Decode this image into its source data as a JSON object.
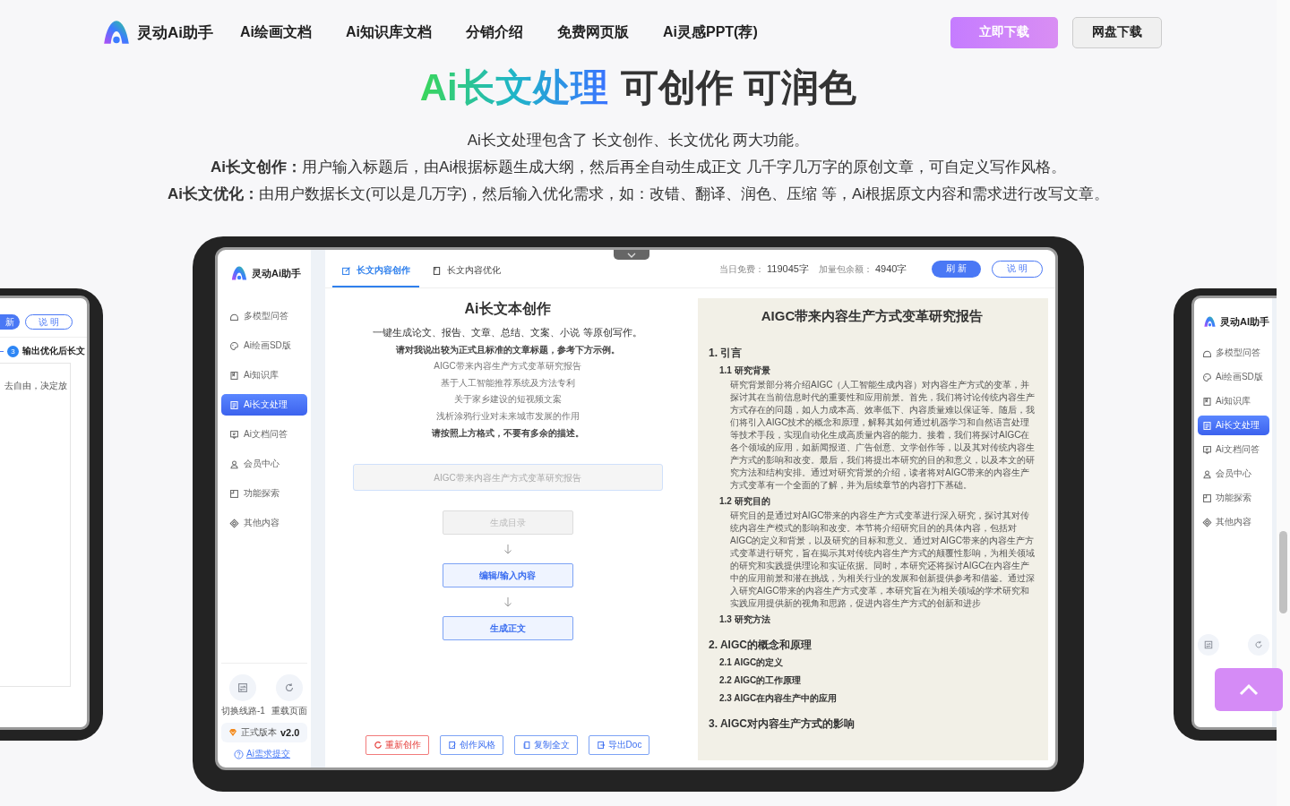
{
  "header": {
    "logo_text": "灵动Ai助手",
    "nav": [
      {
        "label": "Ai绘画文档"
      },
      {
        "label": "Ai知识库文档"
      },
      {
        "label": "分销介绍"
      },
      {
        "label": "免费网页版"
      },
      {
        "label": "Ai灵感PPT(荐)"
      }
    ],
    "buttons": [
      {
        "label": "立即下载",
        "kind": "primary"
      },
      {
        "label": "网盘下载",
        "kind": "secondary"
      }
    ]
  },
  "hero": {
    "title_highlight": "Ai长文处理",
    "title_rest": "可创作 可润色",
    "lines": [
      "Ai长文处理包含了 长文创作、长文优化 两大功能。",
      "**Ai长文创作：**用户输入标题后，由Ai根据标题生成大纲，然后再全自动生成正文 几千字几万字的原创文章，可自定义写作风格。",
      "**Ai长文优化：**由用户数据长文(可以是几万字)，然后输入优化需求，如：改错、翻译、润色、压缩 等，Ai根据原文内容和需求进行改写文章。"
    ]
  },
  "left_device": {
    "buttons": [
      {
        "label": "新",
        "kind": "primary"
      },
      {
        "label": "说 明",
        "kind": "outline"
      }
    ],
    "step": {
      "number": "3",
      "label": "输出优化后长文"
    },
    "text": "去自由，决定放"
  },
  "app": {
    "logo_text": "灵动Ai助手",
    "sidebar": [
      {
        "label": "多模型问答",
        "selected": false
      },
      {
        "label": "Ai绘画SD版",
        "selected": false
      },
      {
        "label": "Ai知识库",
        "selected": false
      },
      {
        "label": "Ai长文处理",
        "selected": true
      },
      {
        "label": "Ai文档问答",
        "selected": false
      },
      {
        "label": "会员中心",
        "selected": false
      },
      {
        "label": "功能探索",
        "selected": false
      },
      {
        "label": "其他内容",
        "selected": false
      }
    ],
    "tools": [
      {
        "label": "切换线路-1"
      },
      {
        "label": "重载页面"
      }
    ],
    "version": {
      "label": "正式版本",
      "value": "v2.0"
    },
    "feedback_link": "Ai需求提交",
    "tabs": [
      {
        "label": "长文内容创作",
        "selected": true
      },
      {
        "label": "长文内容优化",
        "selected": false
      }
    ],
    "quota": [
      {
        "label": "当日免费：",
        "value": "119045字"
      },
      {
        "label": "加量包余额：",
        "value": "4940字"
      }
    ],
    "top_buttons": [
      {
        "label": "刷 新",
        "kind": "primary"
      },
      {
        "label": "说 明",
        "kind": "outline"
      }
    ],
    "creator": {
      "title": "Ai长文本创作",
      "intro": "一键生成论文、报告、文章、总结、文案、小说 等原创写作。",
      "prompt": "请对我说出较为正式且标准的文章标题，参考下方示例。",
      "examples": [
        "AIGC带来内容生产方式变革研究报告",
        "基于人工智能推荐系统及方法专利",
        "关于家乡建设的短视频文案",
        "浅析涂鸦行业对未来城市发展的作用"
      ],
      "note": "请按照上方格式，不要有多余的描述。",
      "title_field": {
        "placeholder": "AIGC带来内容生产方式变革研究报告"
      },
      "steps": [
        {
          "label": "生成目录",
          "disabled": true
        },
        {
          "label": "编辑/输入内容",
          "disabled": false
        },
        {
          "label": "生成正文",
          "disabled": false
        }
      ]
    },
    "actions": [
      {
        "label": "重新创作",
        "kind": "danger"
      },
      {
        "label": "创作风格",
        "kind": "normal"
      },
      {
        "label": "复制全文",
        "kind": "normal"
      },
      {
        "label": "导出Doc",
        "kind": "normal"
      }
    ],
    "document": {
      "title": "AIGC带来内容生产方式变革研究报告",
      "sections": [
        {
          "heading": "1. 引言",
          "children": [
            {
              "heading": "1.1 研究背景",
              "body": "研究背景部分将介绍AIGC（人工智能生成内容）对内容生产方式的变革，并探讨其在当前信息时代的重要性和应用前景。首先，我们将讨论传统内容生产方式存在的问题，如人力成本高、效率低下、内容质量难以保证等。随后，我们将引入AIGC技术的概念和原理，解释其如何通过机器学习和自然语言处理等技术手段，实现自动化生成高质量内容的能力。接着，我们将探讨AIGC在各个领域的应用，如新闻报道、广告创意、文学创作等，以及其对传统内容生产方式的影响和改变。最后，我们将提出本研究的目的和意义，以及本文的研究方法和结构安排。通过对研究背景的介绍，读者将对AIGC带来的内容生产方式变革有一个全面的了解，并为后续章节的内容打下基础。"
            },
            {
              "heading": "1.2 研究目的",
              "body": "研究目的是通过对AIGC带来的内容生产方式变革进行深入研究，探讨其对传统内容生产模式的影响和改变。本节将介绍研究目的的具体内容，包括对AIGC的定义和背景，以及研究的目标和意义。通过对AIGC带来的内容生产方式变革进行研究，旨在揭示其对传统内容生产方式的颠覆性影响，为相关领域的研究和实践提供理论和实证依据。同时，本研究还将探讨AIGC在内容生产中的应用前景和潜在挑战，为相关行业的发展和创新提供参考和借鉴。通过深入研究AIGC带来的内容生产方式变革，本研究旨在为相关领域的学术研究和实践应用提供新的视角和思路，促进内容生产方式的创新和进步"
            },
            {
              "heading": "1.3 研究方法"
            }
          ]
        },
        {
          "heading": "2. AIGC的概念和原理",
          "children": [
            {
              "heading": "2.1 AIGC的定义"
            },
            {
              "heading": "2.2 AIGC的工作原理"
            },
            {
              "heading": "2.3 AIGC在内容生产中的应用"
            }
          ]
        },
        {
          "heading": "3. AIGC对内容生产方式的影响"
        }
      ]
    }
  },
  "right_device": {
    "logo_text": "灵动AI助手",
    "sidebar": [
      {
        "label": "多模型问答",
        "selected": false
      },
      {
        "label": "Ai绘画SD版",
        "selected": false
      },
      {
        "label": "Ai知识库",
        "selected": false
      },
      {
        "label": "Ai长文处理",
        "selected": true
      },
      {
        "label": "Ai文档问答",
        "selected": false
      },
      {
        "label": "会员中心",
        "selected": false
      },
      {
        "label": "功能探索",
        "selected": false
      },
      {
        "label": "其他内容",
        "selected": false
      }
    ]
  }
}
